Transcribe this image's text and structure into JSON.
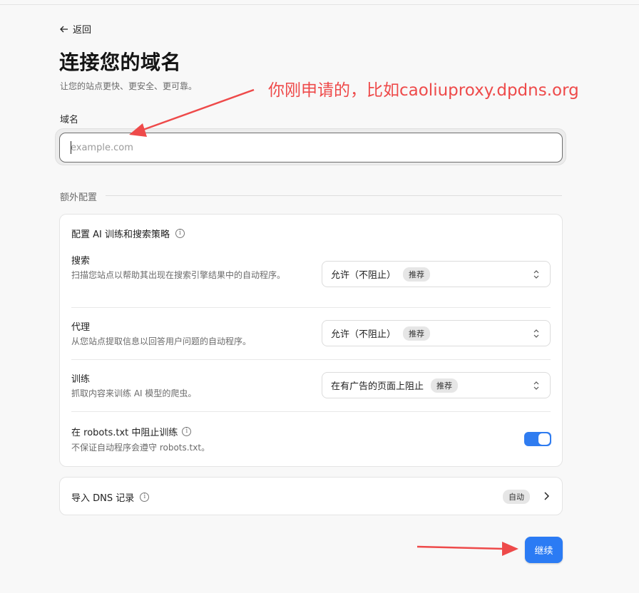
{
  "nav": {
    "back_label": "返回"
  },
  "header": {
    "title": "连接您的域名",
    "subtitle": "让您的站点更快、更安全、更可靠。"
  },
  "domain": {
    "label": "域名",
    "placeholder": "example.com",
    "value": ""
  },
  "extra": {
    "section_label": "额外配置",
    "ai": {
      "title": "配置 AI 训练和搜索策略",
      "rows": [
        {
          "title": "搜索",
          "description": "扫描您站点以帮助其出现在搜索引擎结果中的自动程序。",
          "selected": "允许（不阻止）",
          "badge": "推荐"
        },
        {
          "title": "代理",
          "description": "从您站点提取信息以回答用户问题的自动程序。",
          "selected": "允许（不阻止）",
          "badge": "推荐"
        },
        {
          "title": "训练",
          "description": "抓取内容来训练 AI 模型的爬虫。",
          "selected": "在有广告的页面上阻止",
          "badge": "推荐"
        }
      ],
      "robots": {
        "title": "在 robots.txt 中阻止训练",
        "description": "不保证自动程序会遵守 robots.txt。",
        "enabled": true
      }
    },
    "dns": {
      "title": "导入 DNS 记录",
      "badge": "自动"
    }
  },
  "actions": {
    "continue_label": "继续"
  },
  "annotation": {
    "text": "你刚申请的，比如caoliuproxy.dpdns.org"
  },
  "colors": {
    "accent": "#2b7bf4",
    "annotation": "#ee4a4a"
  }
}
